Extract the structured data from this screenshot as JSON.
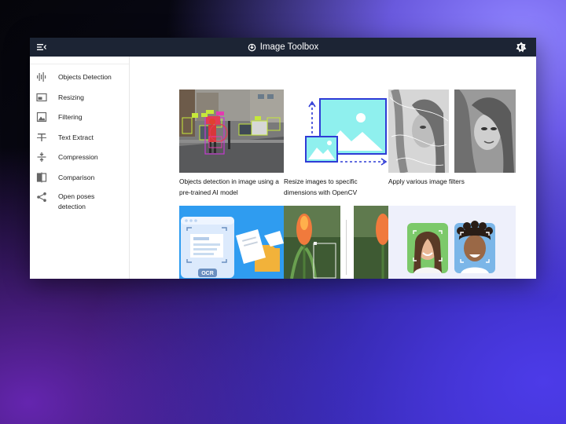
{
  "app": {
    "title": "Image Toolbox"
  },
  "sidebar": {
    "items": [
      {
        "label": "Objects Detection",
        "icon": "waveform-icon"
      },
      {
        "label": "Resizing",
        "icon": "image-resize-icon"
      },
      {
        "label": "Filtering",
        "icon": "filter-image-icon"
      },
      {
        "label": "Text Extract",
        "icon": "text-extract-icon"
      },
      {
        "label": "Compression",
        "icon": "compress-icon"
      },
      {
        "label": "Comparison",
        "icon": "compare-icon"
      },
      {
        "label": "Open poses detection",
        "icon": "share-nodes-icon"
      }
    ]
  },
  "cards": [
    {
      "caption": "Objects detection in image using a pre-trained AI model"
    },
    {
      "caption": "Resize images to specific dimensions with OpenCV"
    },
    {
      "caption": "Apply various image filters"
    },
    {
      "caption": "",
      "badge": "OCR"
    },
    {
      "caption": ""
    },
    {
      "caption": ""
    }
  ],
  "colors": {
    "topbar": "#1c2434",
    "accent": "#2f3bd6",
    "cyan": "#8ff0ee"
  }
}
